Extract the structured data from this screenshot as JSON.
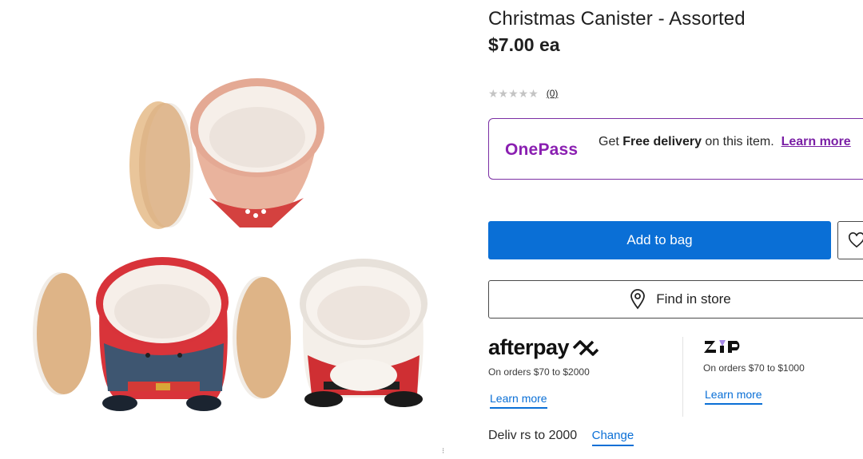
{
  "product": {
    "title": "Christmas Canister - Assorted",
    "price": "$7.00 ea",
    "rating_stars": "★★★★★",
    "review_count": "(0)"
  },
  "onepass": {
    "logo": "OnePass",
    "text_before": "Get ",
    "text_bold": "Free delivery",
    "text_after": " on this item.",
    "learn_more": "Learn more"
  },
  "actions": {
    "add_to_bag": "Add to bag",
    "find_in_store": "Find in store"
  },
  "afterpay": {
    "logo": "afterpay",
    "note": "On orders $70 to $2000",
    "learn_more": "Learn more"
  },
  "zip": {
    "logo": "zip",
    "note": "On orders $70 to $1000",
    "learn_more": "Learn more"
  },
  "delivery": {
    "text": "Deliv  rs to 2000",
    "change": "Change"
  },
  "colors": {
    "primary_blue": "#0a6fd6",
    "onepass_purple": "#8a1fb1"
  }
}
